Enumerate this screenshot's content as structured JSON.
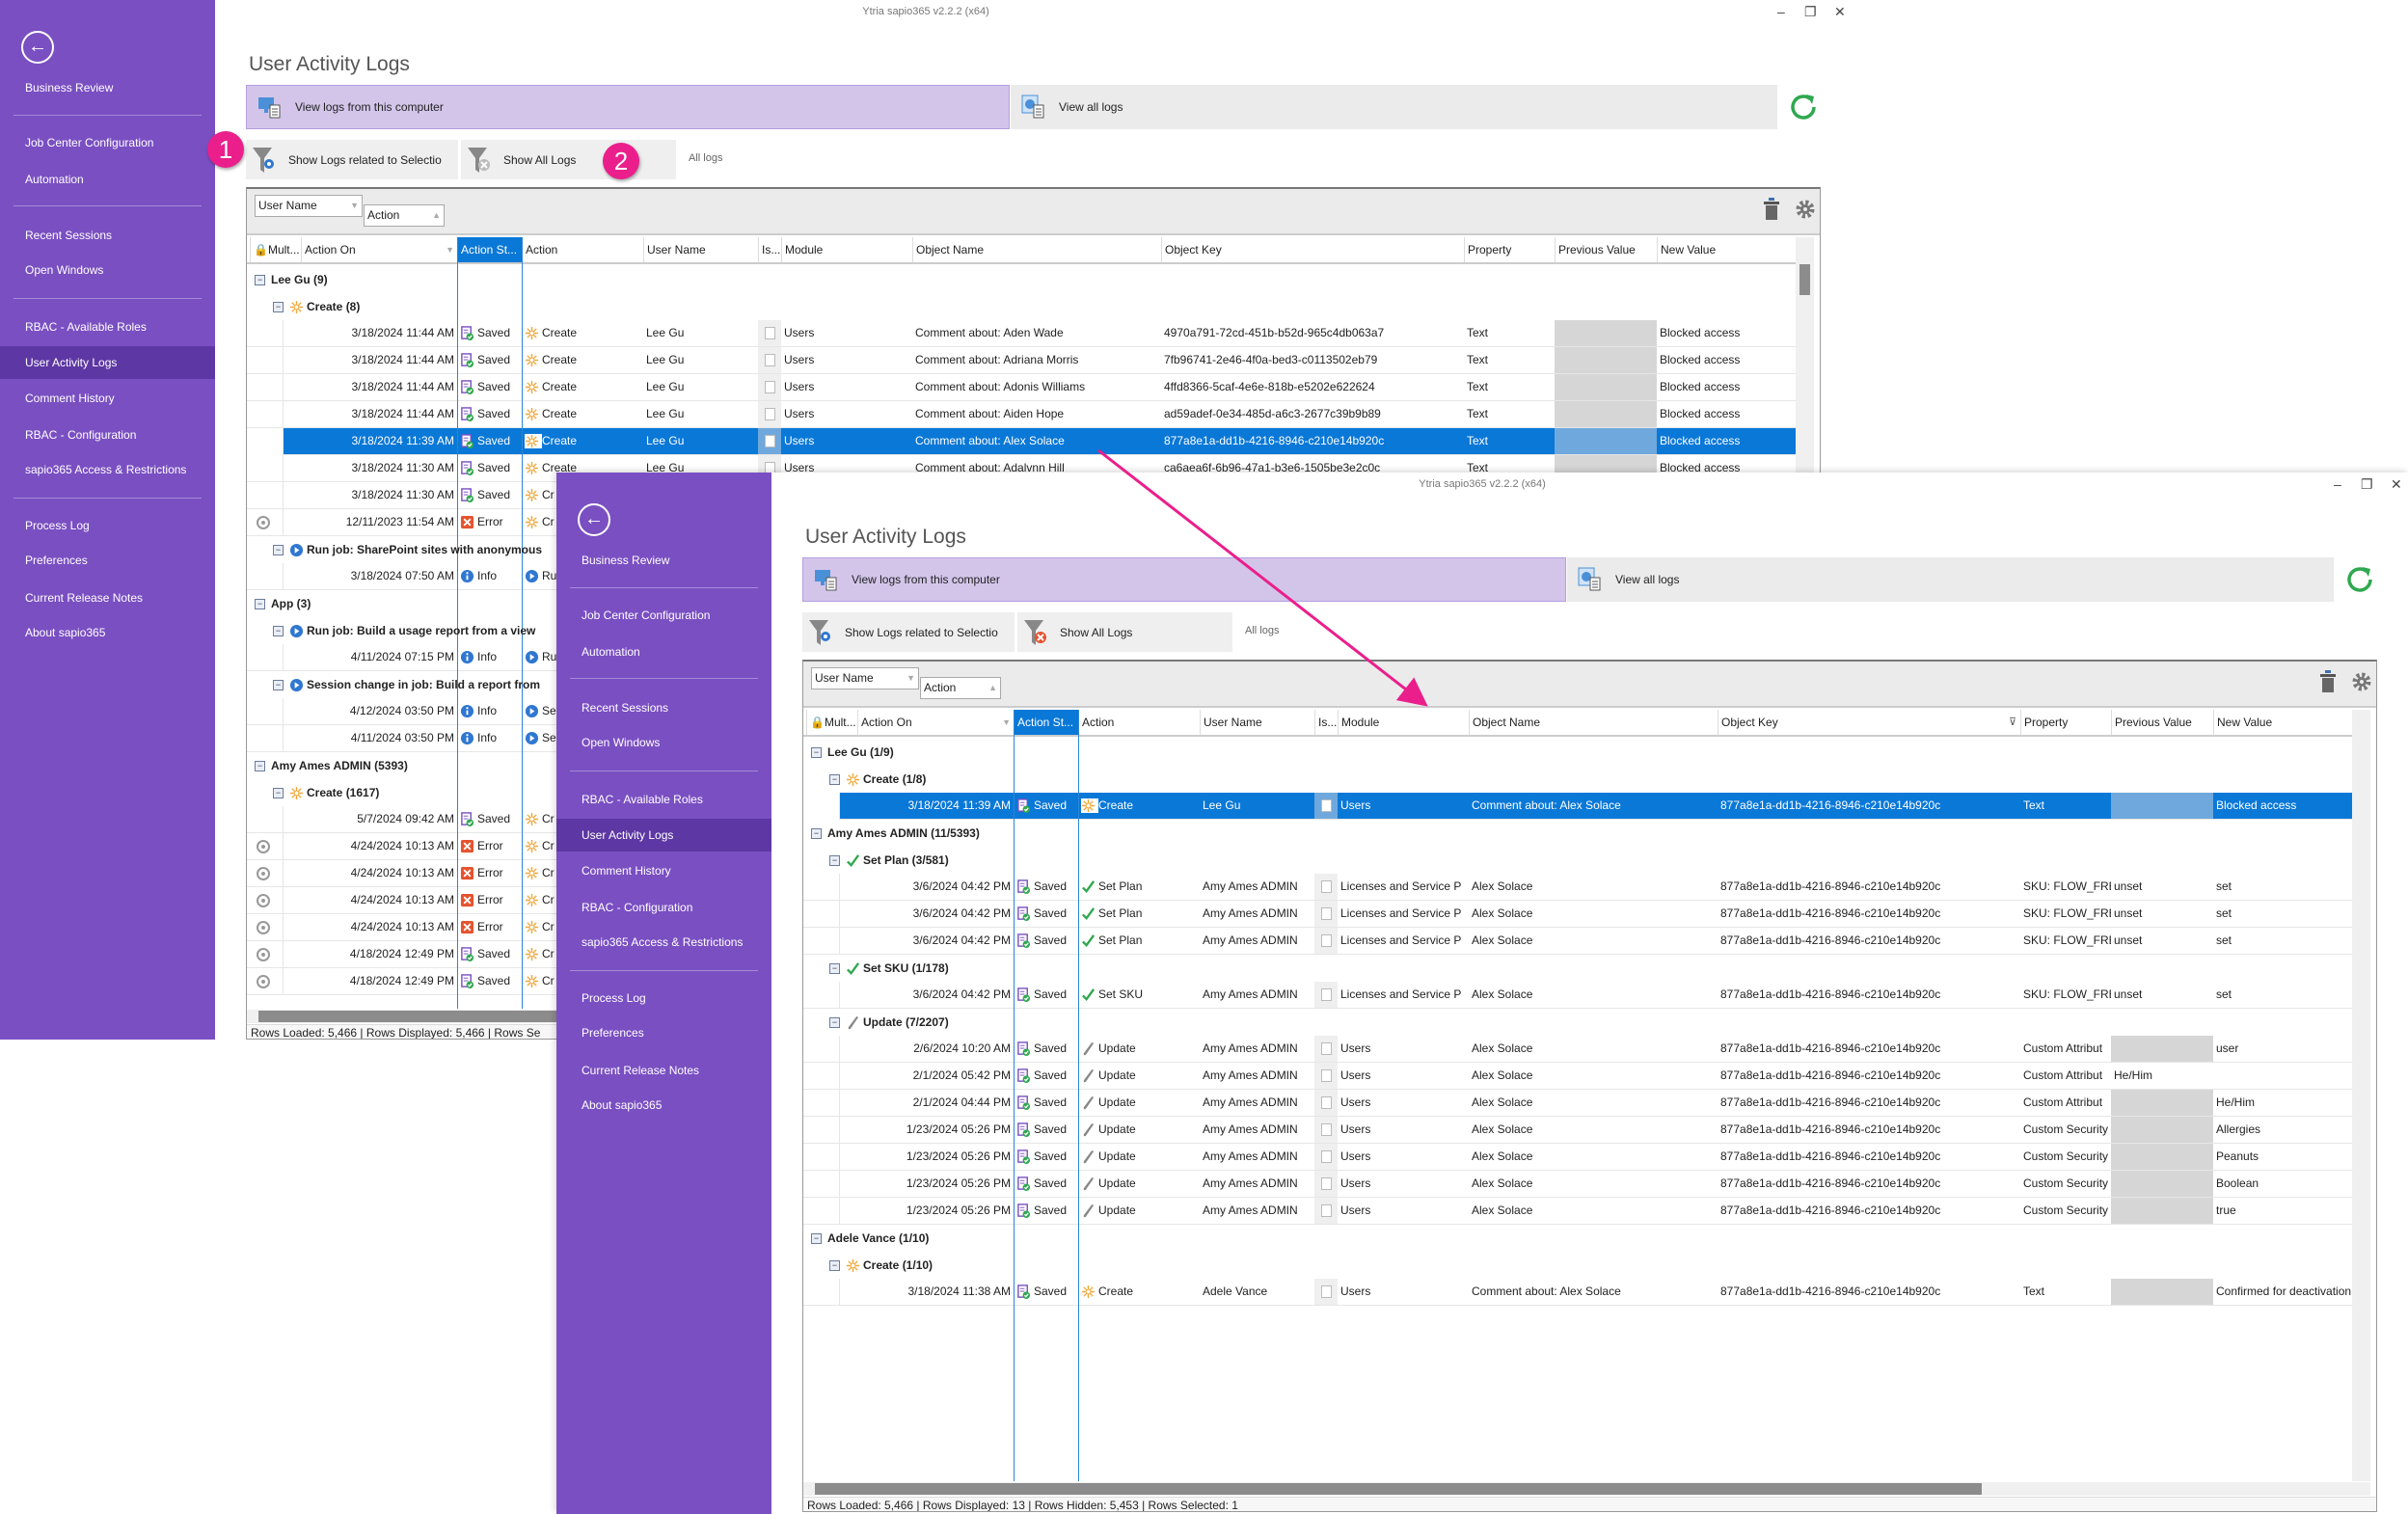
{
  "app": {
    "window_title": "Ytria sapio365 v2.2.2 (x64)",
    "page_title": "User Activity Logs",
    "view_local_label": "View logs from this computer",
    "view_all_label": "View all logs",
    "show_related_label": "Show Logs related to Selectio",
    "show_all_label": "Show All Logs",
    "all_logs_label": "All logs",
    "groupby": [
      "User Name",
      "Action"
    ],
    "columns": [
      "Mult...",
      "Action On",
      "Action St...",
      "Action",
      "User Name",
      "Is...",
      "Module",
      "Object Name",
      "Object Key",
      "Property",
      "Previous Value",
      "New Value"
    ],
    "accent": "#0a78d7",
    "sidebar_color": "#7a4fc2",
    "annotation_color": "#ea1f8c"
  },
  "sidebar": {
    "items": [
      "Business Review",
      "Job Center Configuration",
      "Automation",
      "Recent Sessions",
      "Open Windows",
      "RBAC - Available Roles",
      "User Activity Logs",
      "Comment History",
      "RBAC - Configuration",
      "sapio365 Access & Restrictions",
      "Process Log",
      "Preferences",
      "Current Release Notes",
      "About sapio365"
    ],
    "active": "User Activity Logs"
  },
  "badges": [
    "1",
    "2"
  ],
  "window1": {
    "status": "Rows Loaded: 5,466 | Rows Displayed: 5,466 | Rows Se",
    "rows": [
      {
        "type": "group",
        "level": 0,
        "label": "Lee Gu (9)"
      },
      {
        "type": "group",
        "level": 1,
        "icon": "create",
        "label": "Create (8)"
      },
      {
        "type": "data",
        "date": "3/18/2024 11:44 AM",
        "status": "Saved",
        "status_icon": "saved",
        "action": "Create",
        "action_icon": "create",
        "user": "Lee Gu",
        "is": true,
        "module": "Users",
        "object_name": "Comment about: Aden Wade",
        "object_key": "4970a791-72cd-451b-b52d-965c4db063a7",
        "property": "Text",
        "prev_blank": true,
        "new": "Blocked access"
      },
      {
        "type": "data",
        "date": "3/18/2024 11:44 AM",
        "status": "Saved",
        "status_icon": "saved",
        "action": "Create",
        "action_icon": "create",
        "user": "Lee Gu",
        "is": true,
        "module": "Users",
        "object_name": "Comment about: Adriana Morris",
        "object_key": "7fb96741-2e46-4f0a-bed3-c0113502eb79",
        "property": "Text",
        "prev_blank": true,
        "new": "Blocked access"
      },
      {
        "type": "data",
        "date": "3/18/2024 11:44 AM",
        "status": "Saved",
        "status_icon": "saved",
        "action": "Create",
        "action_icon": "create",
        "user": "Lee Gu",
        "is": true,
        "module": "Users",
        "object_name": "Comment about: Adonis Williams",
        "object_key": "4ffd8366-5caf-4e6e-818b-e5202e622624",
        "property": "Text",
        "prev_blank": true,
        "new": "Blocked access"
      },
      {
        "type": "data",
        "date": "3/18/2024 11:44 AM",
        "status": "Saved",
        "status_icon": "saved",
        "action": "Create",
        "action_icon": "create",
        "user": "Lee Gu",
        "is": true,
        "module": "Users",
        "object_name": "Comment about: Aiden Hope",
        "object_key": "ad59adef-0e34-485d-a6c3-2677c39b9b89",
        "property": "Text",
        "prev_blank": true,
        "new": "Blocked access"
      },
      {
        "type": "data",
        "selected": true,
        "date": "3/18/2024 11:39 AM",
        "status": "Saved",
        "status_icon": "saved",
        "action": "Create",
        "action_icon": "create",
        "user": "Lee Gu",
        "is": true,
        "module": "Users",
        "object_name": "Comment about: Alex Solace",
        "object_key": "877a8e1a-dd1b-4216-8946-c210e14b920c",
        "property": "Text",
        "prev_blank": true,
        "new": "Blocked access"
      },
      {
        "type": "data",
        "date": "3/18/2024 11:30 AM",
        "status": "Saved",
        "status_icon": "saved",
        "action": "Create",
        "action_icon": "create",
        "user": "Lee Gu",
        "is": true,
        "module": "Users",
        "object_name": "Comment about: Adalvnn Hill",
        "object_key": "ca6aea6f-6b96-47a1-b3e6-1505be3e2c0c",
        "property": "Text",
        "prev_blank": true,
        "new": "Blocked access"
      },
      {
        "type": "data",
        "date": "3/18/2024 11:30 AM",
        "status": "Saved",
        "status_icon": "saved",
        "action": "Cr",
        "action_icon": "create"
      },
      {
        "type": "data",
        "mark": "radio",
        "date": "12/11/2023 11:54 AM",
        "status": "Error",
        "status_icon": "error",
        "action": "Cr",
        "action_icon": "create"
      },
      {
        "type": "group",
        "level": 1,
        "icon": "run",
        "label": "Run job: SharePoint sites with anonymous"
      },
      {
        "type": "data",
        "date": "3/18/2024 07:50 AM",
        "status": "Info",
        "status_icon": "info",
        "action": "Ru",
        "action_icon": "run"
      },
      {
        "type": "group",
        "level": 0,
        "label": "App (3)"
      },
      {
        "type": "group",
        "level": 1,
        "icon": "run",
        "label": "Run job: Build a usage report from a view"
      },
      {
        "type": "data",
        "date": "4/11/2024 07:15 PM",
        "status": "Info",
        "status_icon": "info",
        "action": "Ru",
        "action_icon": "run"
      },
      {
        "type": "group",
        "level": 1,
        "icon": "run",
        "label": "Session change in job: Build a report from"
      },
      {
        "type": "data",
        "date": "4/12/2024 03:50 PM",
        "status": "Info",
        "status_icon": "info",
        "action": "Se",
        "action_icon": "run"
      },
      {
        "type": "data",
        "date": "4/11/2024 03:50 PM",
        "status": "Info",
        "status_icon": "info",
        "action": "Se",
        "action_icon": "run"
      },
      {
        "type": "group",
        "level": 0,
        "label": "Amy Ames ADMIN (5393)"
      },
      {
        "type": "group",
        "level": 1,
        "icon": "create",
        "label": "Create (1617)"
      },
      {
        "type": "data",
        "date": "5/7/2024 09:42 AM",
        "status": "Saved",
        "status_icon": "saved",
        "action": "Cr",
        "action_icon": "create"
      },
      {
        "type": "data",
        "mark": "radio",
        "date": "4/24/2024 10:13 AM",
        "status": "Error",
        "status_icon": "error",
        "action": "Cr",
        "action_icon": "create"
      },
      {
        "type": "data",
        "mark": "radio",
        "date": "4/24/2024 10:13 AM",
        "status": "Error",
        "status_icon": "error",
        "action": "Cr",
        "action_icon": "create"
      },
      {
        "type": "data",
        "mark": "radio",
        "date": "4/24/2024 10:13 AM",
        "status": "Error",
        "status_icon": "error",
        "action": "Cr",
        "action_icon": "create"
      },
      {
        "type": "data",
        "mark": "radio",
        "date": "4/24/2024 10:13 AM",
        "status": "Error",
        "status_icon": "error",
        "action": "Cr",
        "action_icon": "create"
      },
      {
        "type": "data",
        "mark": "radio",
        "date": "4/18/2024 12:49 PM",
        "status": "Saved",
        "status_icon": "saved",
        "action": "Cr",
        "action_icon": "create"
      },
      {
        "type": "data",
        "mark": "radio",
        "date": "4/18/2024 12:49 PM",
        "status": "Saved",
        "status_icon": "saved",
        "action": "Cr",
        "action_icon": "create"
      }
    ]
  },
  "window2": {
    "status": "Rows Loaded: 5,466 | Rows Displayed: 13 | Rows Hidden: 5,453 | Rows Selected: 1",
    "object_key_filtered": true,
    "rows": [
      {
        "type": "group",
        "level": 0,
        "label": "Lee Gu (1/9)"
      },
      {
        "type": "group",
        "level": 1,
        "icon": "create",
        "label": "Create (1/8)"
      },
      {
        "type": "data",
        "selected": true,
        "date": "3/18/2024 11:39 AM",
        "status": "Saved",
        "status_icon": "saved",
        "action": "Create",
        "action_icon": "create",
        "user": "Lee Gu",
        "is": true,
        "module": "Users",
        "object_name": "Comment about: Alex Solace",
        "object_key": "877a8e1a-dd1b-4216-8946-c210e14b920c",
        "property": "Text",
        "prev_blank": true,
        "new": "Blocked access"
      },
      {
        "type": "group",
        "level": 0,
        "label": "Amy Ames ADMIN (11/5393)"
      },
      {
        "type": "group",
        "level": 1,
        "icon": "check",
        "label": "Set Plan (3/581)"
      },
      {
        "type": "data",
        "date": "3/6/2024 04:42 PM",
        "status": "Saved",
        "status_icon": "saved",
        "action": "Set Plan",
        "action_icon": "check",
        "user": "Amy Ames ADMIN",
        "is": true,
        "module": "Licenses and Service P",
        "object_name": "Alex Solace",
        "object_key": "877a8e1a-dd1b-4216-8946-c210e14b920c",
        "property": "SKU: FLOW_FRE",
        "prev": "unset",
        "new": "set"
      },
      {
        "type": "data",
        "date": "3/6/2024 04:42 PM",
        "status": "Saved",
        "status_icon": "saved",
        "action": "Set Plan",
        "action_icon": "check",
        "user": "Amy Ames ADMIN",
        "is": true,
        "module": "Licenses and Service P",
        "object_name": "Alex Solace",
        "object_key": "877a8e1a-dd1b-4216-8946-c210e14b920c",
        "property": "SKU: FLOW_FRE",
        "prev": "unset",
        "new": "set"
      },
      {
        "type": "data",
        "date": "3/6/2024 04:42 PM",
        "status": "Saved",
        "status_icon": "saved",
        "action": "Set Plan",
        "action_icon": "check",
        "user": "Amy Ames ADMIN",
        "is": true,
        "module": "Licenses and Service P",
        "object_name": "Alex Solace",
        "object_key": "877a8e1a-dd1b-4216-8946-c210e14b920c",
        "property": "SKU: FLOW_FRE",
        "prev": "unset",
        "new": "set"
      },
      {
        "type": "group",
        "level": 1,
        "icon": "check",
        "label": "Set SKU (1/178)"
      },
      {
        "type": "data",
        "date": "3/6/2024 04:42 PM",
        "status": "Saved",
        "status_icon": "saved",
        "action": "Set SKU",
        "action_icon": "check",
        "user": "Amy Ames ADMIN",
        "is": true,
        "module": "Licenses and Service P",
        "object_name": "Alex Solace",
        "object_key": "877a8e1a-dd1b-4216-8946-c210e14b920c",
        "property": "SKU: FLOW_FRE",
        "prev": "unset",
        "new": "set"
      },
      {
        "type": "group",
        "level": 1,
        "icon": "pencil",
        "label": "Update (7/2207)"
      },
      {
        "type": "data",
        "date": "2/6/2024 10:20 AM",
        "status": "Saved",
        "status_icon": "saved",
        "action": "Update",
        "action_icon": "pencil",
        "user": "Amy Ames ADMIN",
        "is": true,
        "module": "Users",
        "object_name": "Alex Solace",
        "object_key": "877a8e1a-dd1b-4216-8946-c210e14b920c",
        "property": "Custom Attribut",
        "prev_blank": true,
        "new": "user"
      },
      {
        "type": "data",
        "date": "2/1/2024 05:42 PM",
        "status": "Saved",
        "status_icon": "saved",
        "action": "Update",
        "action_icon": "pencil",
        "user": "Amy Ames ADMIN",
        "is": true,
        "module": "Users",
        "object_name": "Alex Solace",
        "object_key": "877a8e1a-dd1b-4216-8946-c210e14b920c",
        "property": "Custom Attribut",
        "prev": "He/Him",
        "new": ""
      },
      {
        "type": "data",
        "date": "2/1/2024 04:44 PM",
        "status": "Saved",
        "status_icon": "saved",
        "action": "Update",
        "action_icon": "pencil",
        "user": "Amy Ames ADMIN",
        "is": true,
        "module": "Users",
        "object_name": "Alex Solace",
        "object_key": "877a8e1a-dd1b-4216-8946-c210e14b920c",
        "property": "Custom Attribut",
        "prev_blank": true,
        "new": "He/Him"
      },
      {
        "type": "data",
        "date": "1/23/2024 05:26 PM",
        "status": "Saved",
        "status_icon": "saved",
        "action": "Update",
        "action_icon": "pencil",
        "user": "Amy Ames ADMIN",
        "is": true,
        "module": "Users",
        "object_name": "Alex Solace",
        "object_key": "877a8e1a-dd1b-4216-8946-c210e14b920c",
        "property": "Custom Security",
        "prev_blank": true,
        "new": "Allergies"
      },
      {
        "type": "data",
        "date": "1/23/2024 05:26 PM",
        "status": "Saved",
        "status_icon": "saved",
        "action": "Update",
        "action_icon": "pencil",
        "user": "Amy Ames ADMIN",
        "is": true,
        "module": "Users",
        "object_name": "Alex Solace",
        "object_key": "877a8e1a-dd1b-4216-8946-c210e14b920c",
        "property": "Custom Security",
        "prev_blank": true,
        "new": "Peanuts"
      },
      {
        "type": "data",
        "date": "1/23/2024 05:26 PM",
        "status": "Saved",
        "status_icon": "saved",
        "action": "Update",
        "action_icon": "pencil",
        "user": "Amy Ames ADMIN",
        "is": true,
        "module": "Users",
        "object_name": "Alex Solace",
        "object_key": "877a8e1a-dd1b-4216-8946-c210e14b920c",
        "property": "Custom Security",
        "prev_blank": true,
        "new": "Boolean"
      },
      {
        "type": "data",
        "date": "1/23/2024 05:26 PM",
        "status": "Saved",
        "status_icon": "saved",
        "action": "Update",
        "action_icon": "pencil",
        "user": "Amy Ames ADMIN",
        "is": true,
        "module": "Users",
        "object_name": "Alex Solace",
        "object_key": "877a8e1a-dd1b-4216-8946-c210e14b920c",
        "property": "Custom Security",
        "prev_blank": true,
        "new": "true"
      },
      {
        "type": "group",
        "level": 0,
        "label": "Adele Vance (1/10)"
      },
      {
        "type": "group",
        "level": 1,
        "icon": "create",
        "label": "Create (1/10)"
      },
      {
        "type": "data",
        "date": "3/18/2024 11:38 AM",
        "status": "Saved",
        "status_icon": "saved",
        "action": "Create",
        "action_icon": "create",
        "user": "Adele Vance",
        "is": true,
        "module": "Users",
        "object_name": "Comment about: Alex Solace",
        "object_key": "877a8e1a-dd1b-4216-8946-c210e14b920c",
        "property": "Text",
        "prev_blank": true,
        "new": "Confirmed for deactivation"
      }
    ]
  }
}
